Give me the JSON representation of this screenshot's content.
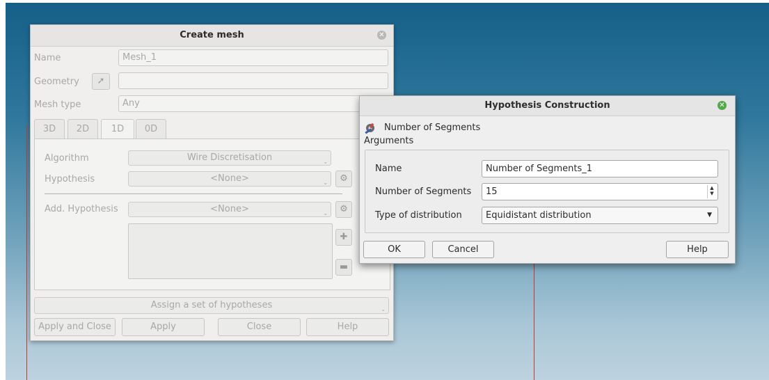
{
  "create_mesh": {
    "title": "Create mesh",
    "name_label": "Name",
    "name_value": "Mesh_1",
    "geometry_label": "Geometry",
    "geometry_value": "",
    "mesh_type_label": "Mesh type",
    "mesh_type_value": "Any",
    "tabs": [
      "3D",
      "2D",
      "1D",
      "0D"
    ],
    "active_tab": "1D",
    "algorithm_label": "Algorithm",
    "algorithm_value": "Wire Discretisation",
    "hypothesis_label": "Hypothesis",
    "hypothesis_value": "<None>",
    "add_hypothesis_label": "Add. Hypothesis",
    "add_hypothesis_value": "<None>",
    "assign_set_label": "Assign a set of hypotheses",
    "buttons": {
      "apply_close": "Apply and Close",
      "apply": "Apply",
      "close": "Close",
      "help": "Help"
    }
  },
  "hypothesis_dialog": {
    "title": "Hypothesis Construction",
    "header_label": "Number of Segments",
    "arguments_label": "Arguments",
    "name_label": "Name",
    "name_value": "Number of Segments_1",
    "segments_label": "Number of Segments",
    "segments_value": "15",
    "distribution_label": "Type of distribution",
    "distribution_value": "Equidistant distribution",
    "buttons": {
      "ok": "OK",
      "cancel": "Cancel",
      "help": "Help"
    }
  },
  "colors": {
    "viewport_top": "#155f88",
    "viewport_bottom": "#bdd3df",
    "axis_line": "#c43a2a",
    "close_active": "#52a84a",
    "close_inactive": "#b8b8b8"
  }
}
